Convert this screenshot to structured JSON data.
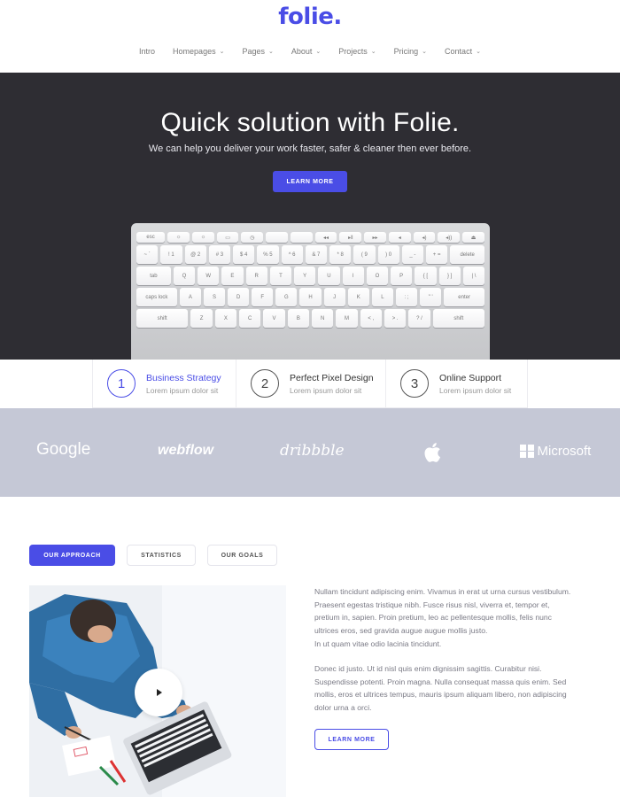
{
  "brand": {
    "logo": "folie.",
    "accent": "#4a4de6"
  },
  "nav": {
    "items": [
      {
        "label": "Intro",
        "dropdown": false
      },
      {
        "label": "Homepages",
        "dropdown": true
      },
      {
        "label": "Pages",
        "dropdown": true
      },
      {
        "label": "About",
        "dropdown": true
      },
      {
        "label": "Projects",
        "dropdown": true
      },
      {
        "label": "Pricing",
        "dropdown": true
      },
      {
        "label": "Contact",
        "dropdown": true
      }
    ]
  },
  "hero": {
    "title": "Quick solution with Folie.",
    "subtitle": "We can help you deliver your work faster, safer & cleaner then ever before.",
    "button_label": "LEARN MORE",
    "background": "#2e2d33"
  },
  "features": [
    {
      "number": "1",
      "title": "Business Strategy",
      "subtitle": "Lorem ipsum dolor sit",
      "active": true
    },
    {
      "number": "2",
      "title": "Perfect Pixel Design",
      "subtitle": "Lorem ipsum dolor sit",
      "active": false
    },
    {
      "number": "3",
      "title": "Online Support",
      "subtitle": "Lorem ipsum dolor sit",
      "active": false
    }
  ],
  "brands": [
    "Google",
    "webflow",
    "dribbble",
    "apple-logo",
    "Microsoft"
  ],
  "tabs": [
    {
      "label": "OUR APPROACH",
      "active": true
    },
    {
      "label": "STATISTICS",
      "active": false
    },
    {
      "label": "OUR GOALS",
      "active": false
    }
  ],
  "content": {
    "p1": "Nullam tincidunt adipiscing enim. Vivamus in erat ut urna cursus vestibulum. Praesent egestas tristique nibh. Fusce risus nisl, viverra et, tempor et, pretium in, sapien. Proin pretium, leo ac pellentesque mollis, felis nunc ultrices eros, sed gravida augue augue mollis justo.",
    "p2": "In ut quam vitae odio lacinia tincidunt.",
    "p3": "Donec id justo. Ut id nisl quis enim dignissim sagittis. Curabitur nisi. Suspendisse potenti. Proin magna. Nulla consequat massa quis enim. Sed mollis, eros et ultrices tempus, mauris ipsum aliquam libero, non adipiscing dolor urna a orci.",
    "button_label": "LEARN MORE"
  },
  "keyboard": {
    "fn_row": [
      "esc",
      "☼",
      "☼",
      "▭",
      "◷",
      "",
      "",
      "◂◂",
      "▸ǁ",
      "▸▸",
      "◂",
      "◂)",
      "◂))",
      "⏏"
    ],
    "num_row": [
      "~ `",
      "! 1",
      "@ 2",
      "# 3",
      "$ 4",
      "% 5",
      "^ 6",
      "& 7",
      "* 8",
      "( 9",
      ") 0",
      "_ -",
      "+ =",
      "delete"
    ],
    "q_row": [
      "tab",
      "Q",
      "W",
      "E",
      "R",
      "T",
      "Y",
      "U",
      "I",
      "O",
      "P",
      "{ [",
      "} ]",
      "| \\"
    ],
    "a_row": [
      "caps lock",
      "A",
      "S",
      "D",
      "F",
      "G",
      "H",
      "J",
      "K",
      "L",
      ": ;",
      "\" '",
      "enter"
    ],
    "z_row": [
      "shift",
      "Z",
      "X",
      "C",
      "V",
      "B",
      "N",
      "M",
      "< ,",
      "> .",
      "? /",
      "shift"
    ]
  }
}
